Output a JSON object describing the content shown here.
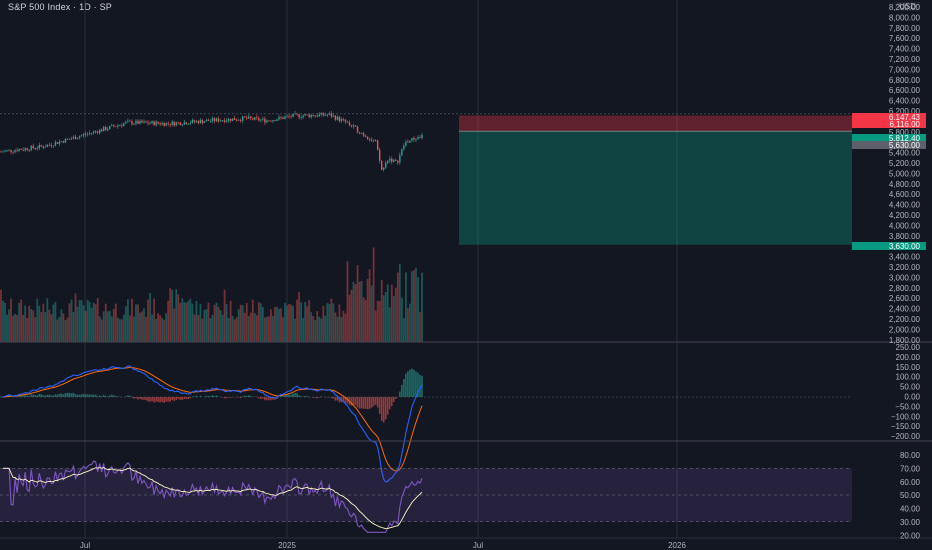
{
  "header": {
    "symbol_title": "S&P 500 Index · 1D · SP",
    "currency": "USD"
  },
  "price_axis": {
    "ticks": [
      "8,200.00",
      "8,000.00",
      "7,800.00",
      "7,600.00",
      "7,400.00",
      "7,200.00",
      "7,000.00",
      "6,800.00",
      "6,600.00",
      "6,400.00",
      "6,200.00",
      "6,000.00",
      "5,800.00",
      "5,600.00",
      "5,400.00",
      "5,200.00",
      "5,000.00",
      "4,800.00",
      "4,600.00",
      "4,400.00",
      "4,200.00",
      "4,000.00",
      "3,800.00",
      "3,600.00",
      "3,400.00",
      "3,200.00",
      "3,000.00",
      "2,800.00",
      "2,600.00",
      "2,400.00",
      "2,200.00",
      "2,000.00",
      "1,800.00"
    ],
    "badges": [
      {
        "text": "6,147.43",
        "color": "#f23645"
      },
      {
        "text": "6,116.00",
        "color": "#f23645"
      },
      {
        "text": "5,812.40",
        "color": "#089981"
      },
      {
        "text": "5,630.00",
        "color": "#5d606b"
      },
      {
        "text": "3,630.00",
        "color": "#089981"
      }
    ]
  },
  "macd_axis": {
    "ticks": [
      "250.00",
      "200.00",
      "150.00",
      "100.00",
      "50.00",
      "0.00",
      "−50.00",
      "−100.00",
      "−150.00",
      "−200.00"
    ]
  },
  "rsi_axis": {
    "ticks": [
      "80.00",
      "70.00",
      "60.00",
      "50.00",
      "40.00",
      "30.00",
      "20.00"
    ]
  },
  "time_axis": {
    "ticks": [
      "Jul",
      "2025",
      "Jul",
      "2026"
    ]
  },
  "position": {
    "entry": 5812.4,
    "stop": 6116.0,
    "target": 3630.0,
    "colors": {
      "loss": "#f23645",
      "profit": "#089981"
    }
  },
  "colors": {
    "background": "#131722",
    "up": "#26a69a",
    "down": "#ef5350",
    "macd": "#2962ff",
    "signal": "#ff6d00",
    "rsi": "#7e57c2",
    "rsi_ma": "#fff9c4"
  }
}
